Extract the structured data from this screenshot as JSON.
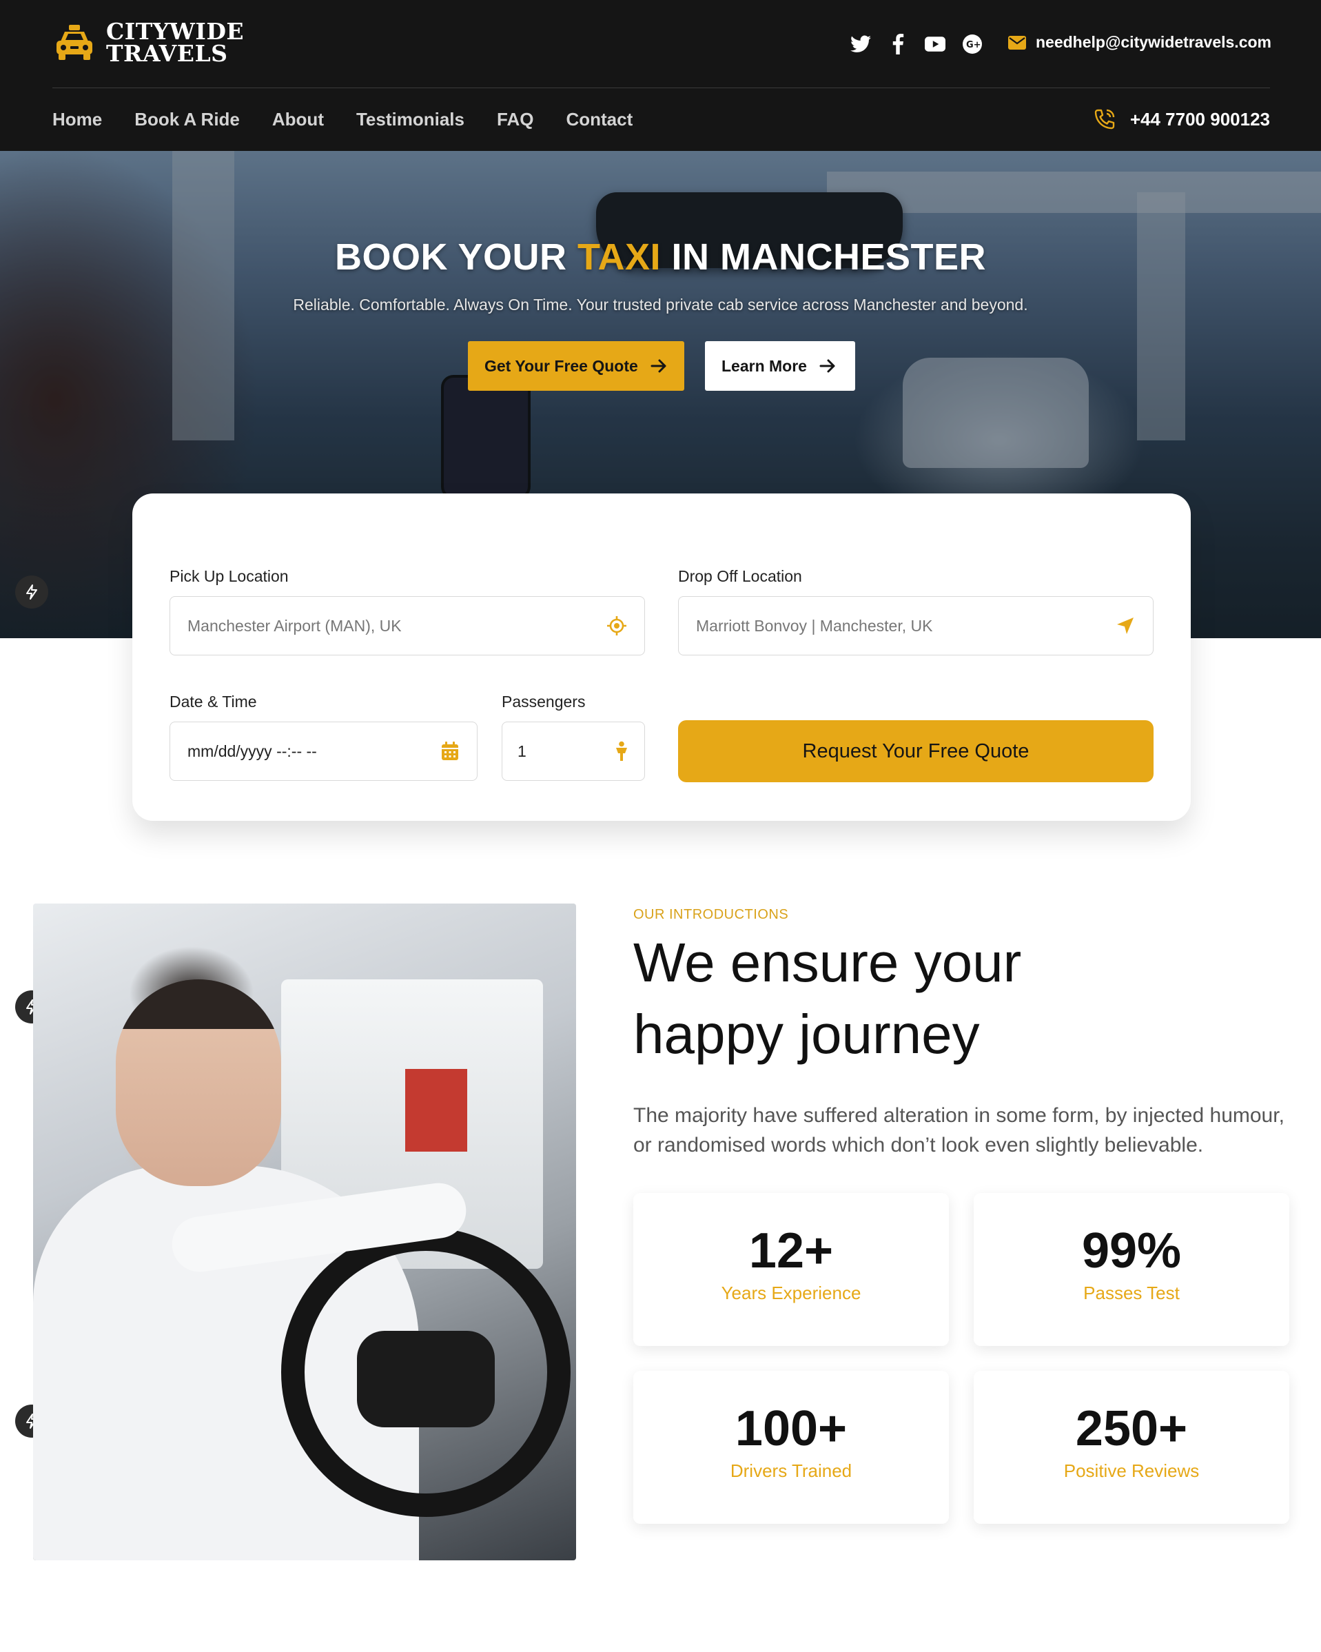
{
  "brand": {
    "line1": "CITYWIDE",
    "line2": "TRAVELS",
    "logo_icon": "taxi-icon"
  },
  "header": {
    "socials": [
      "twitter-icon",
      "facebook-icon",
      "youtube-icon",
      "google-plus-icon"
    ],
    "email": "needhelp@citywidetravels.com",
    "phone": "+44 7700 900123"
  },
  "nav": {
    "items": [
      "Home",
      "Book A Ride",
      "About",
      "Testimonials",
      "FAQ",
      "Contact"
    ]
  },
  "hero": {
    "title_pre": "BOOK YOUR ",
    "title_accent": "TAXI",
    "title_post": " IN MANCHESTER",
    "subtitle": "Reliable. Comfortable. Always On Time. Your trusted private cab service across Manchester and beyond.",
    "primary_button": "Get Your Free Quote",
    "secondary_button": "Learn More"
  },
  "booking": {
    "pickup_label": "Pick Up Location",
    "pickup_placeholder": "Manchester Airport (MAN), UK",
    "dropoff_label": "Drop Off Location",
    "dropoff_placeholder": "Marriott Bonvoy | Manchester, UK",
    "datetime_label": "Date & Time",
    "datetime_value": "mm/dd/yyyy --:-- --",
    "passengers_label": "Passengers",
    "passengers_value": "1",
    "submit_label": "Request Your Free Quote"
  },
  "intro": {
    "eyebrow": "OUR INTRODUCTIONS",
    "title": "We ensure your happy journey",
    "text": "The majority have suffered alteration in some form, by injected humour, or randomised words which don’t look even slightly believable.",
    "stats": [
      {
        "value": "12+",
        "label": "Years Experience"
      },
      {
        "value": "99%",
        "label": "Passes Test"
      },
      {
        "value": "100+",
        "label": "Drivers Trained"
      },
      {
        "value": "250+",
        "label": "Positive Reviews"
      }
    ]
  },
  "colors": {
    "accent": "#e6a817",
    "header_bg": "#151515"
  }
}
